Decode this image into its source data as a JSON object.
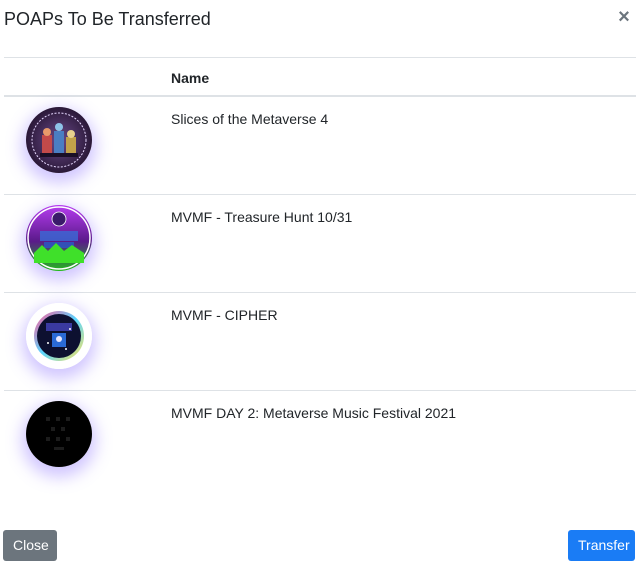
{
  "modal": {
    "title": "POAPs To Be Transferred",
    "close_icon": "close-icon"
  },
  "table": {
    "columns": [
      "",
      "Name"
    ],
    "rows": [
      {
        "name": "Slices of the Metaverse 4",
        "image": "poap-badge-slices-of-metaverse"
      },
      {
        "name": "MVMF - Treasure Hunt 10/31",
        "image": "poap-badge-treasure-hunt"
      },
      {
        "name": "MVMF - CIPHER",
        "image": "poap-badge-cipher"
      },
      {
        "name": "MVMF DAY 2: Metaverse Music Festival 2021",
        "image": "poap-badge-mvmf-day2"
      }
    ]
  },
  "footer": {
    "close_label": "Close",
    "transfer_label": "Transfer"
  },
  "colors": {
    "close_button": "#6c757d",
    "transfer_button": "#1a7cf5",
    "badge_glow": "#7a5aff"
  }
}
